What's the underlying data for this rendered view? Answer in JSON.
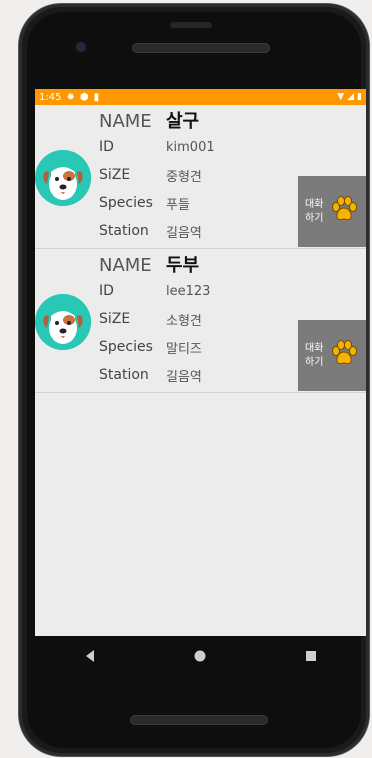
{
  "status_bar": {
    "time": "1:45"
  },
  "chat_label_line1": "대화",
  "chat_label_line2": "하기",
  "labels": {
    "name": "NAME",
    "id": "ID",
    "size": "SiZE",
    "species": "Species",
    "station": "Station"
  },
  "pets": [
    {
      "name": "살구",
      "id": "kim001",
      "size": "중형견",
      "species": "푸들",
      "station": "길음역"
    },
    {
      "name": "두부",
      "id": "lee123",
      "size": "소형견",
      "species": "말티즈",
      "station": "길음역"
    }
  ],
  "colors": {
    "status_bar": "#ff9800",
    "chat_button": "#7b7b7b",
    "avatar_bg": "#29c7b5",
    "paw": "#f5b400"
  }
}
